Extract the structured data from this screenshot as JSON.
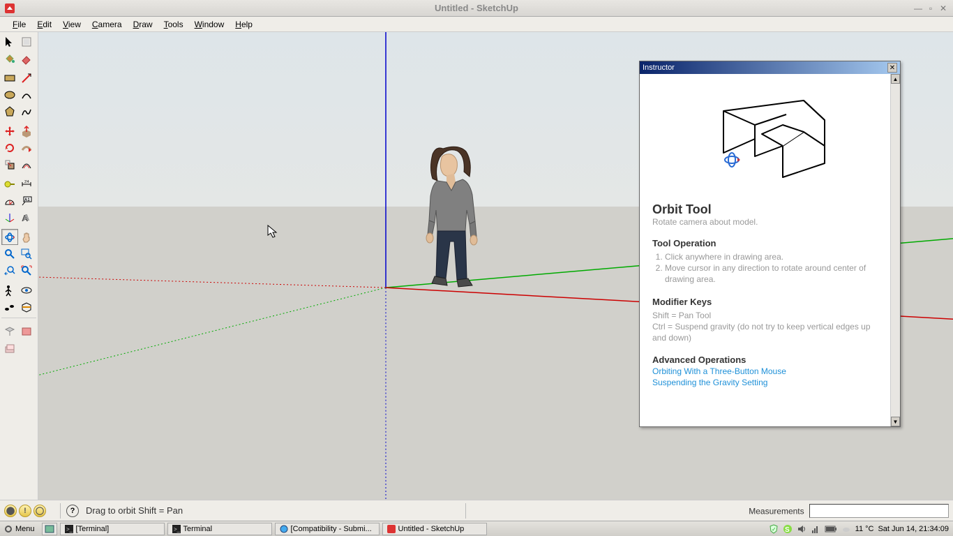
{
  "window": {
    "title": "Untitled - SketchUp",
    "menubar": [
      "File",
      "Edit",
      "View",
      "Camera",
      "Draw",
      "Tools",
      "Window",
      "Help"
    ]
  },
  "statusbar": {
    "hint": "Drag to orbit   Shift = Pan",
    "measurements_label": "Measurements"
  },
  "instructor": {
    "panel_title": "Instructor",
    "title": "Orbit Tool",
    "subtitle": "Rotate camera about model.",
    "operation_heading": "Tool Operation",
    "op1": "Click anywhere in drawing area.",
    "op2": "Move cursor in any direction to rotate around center of drawing area.",
    "modifier_heading": "Modifier Keys",
    "mod1": "Shift = Pan Tool",
    "mod2": "Ctrl = Suspend gravity (do not try to keep vertical edges up and down)",
    "advanced_heading": "Advanced Operations",
    "link1": "Orbiting With a Three-Button Mouse",
    "link2": "Suspending the Gravity Setting"
  },
  "taskbar": {
    "menu": "Menu",
    "tasks": [
      "[Terminal]",
      "Terminal",
      "[Compatibility - Submi...",
      "Untitled - SketchUp"
    ],
    "weather": "11 °C",
    "datetime": "Sat Jun 14, 21:34:09"
  }
}
